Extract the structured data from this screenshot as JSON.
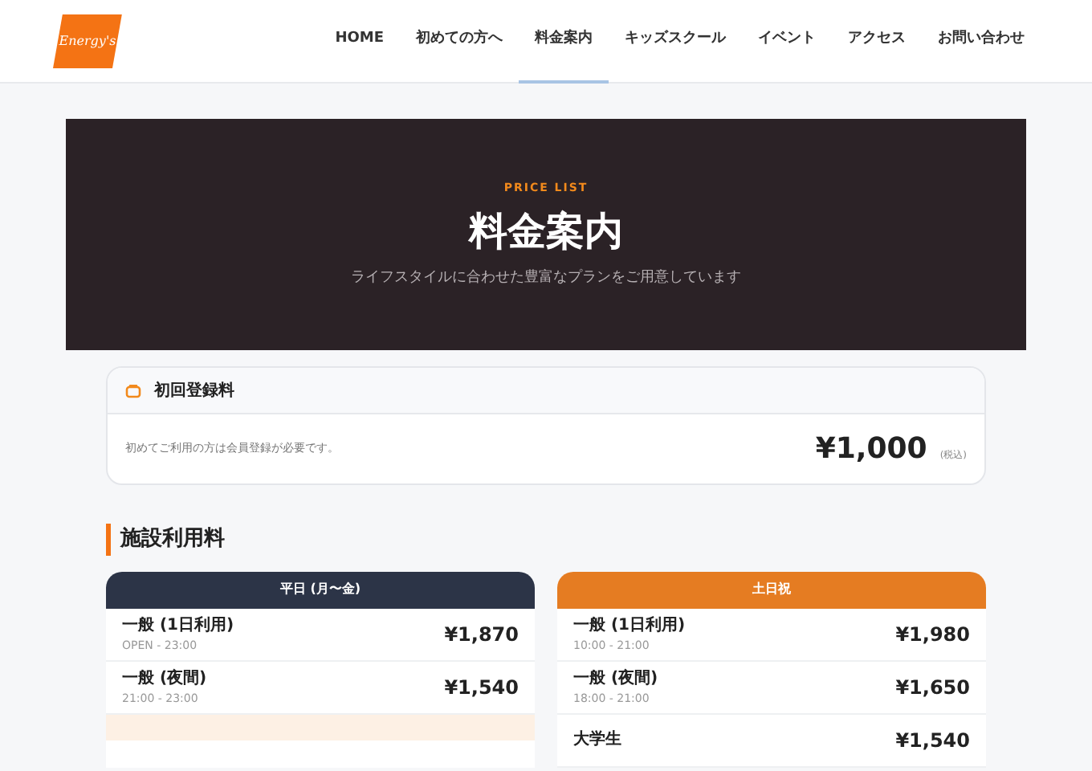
{
  "logo": {
    "text": "Energy's"
  },
  "nav": [
    {
      "label": "HOME",
      "selected": false
    },
    {
      "label": "初めての方へ",
      "selected": false
    },
    {
      "label": "料金案内",
      "selected": true
    },
    {
      "label": "キッズスクール",
      "selected": false
    },
    {
      "label": "イベント",
      "selected": false
    },
    {
      "label": "アクセス",
      "selected": false
    },
    {
      "label": "お問い合わせ",
      "selected": false
    }
  ],
  "hero": {
    "eyebrow": "PRICE LIST",
    "title": "料金案内",
    "subtitle": "ライフスタイルに合わせた豊富なプランをご用意しています"
  },
  "registration": {
    "title": "初回登録料",
    "note": "初めてご利用の方は会員登録が必要です。",
    "price": "¥1,000",
    "tax": "(税込)"
  },
  "section_title": "施設利用料",
  "plans": [
    {
      "title": "平日 (月〜金)",
      "kind": "weekday",
      "rows": [
        {
          "name": "一般 (1日利用)",
          "hours": "OPEN - 23:00",
          "price": "¥1,870"
        },
        {
          "name": "一般 (夜間)",
          "hours": "21:00 - 23:00",
          "price": "¥1,540"
        }
      ],
      "has_highlight_row": true
    },
    {
      "title": "土日祝",
      "kind": "weekend",
      "rows": [
        {
          "name": "一般 (1日利用)",
          "hours": "10:00 - 21:00",
          "price": "¥1,980"
        },
        {
          "name": "一般 (夜間)",
          "hours": "18:00 - 21:00",
          "price": "¥1,650"
        },
        {
          "name": "大学生",
          "price": "¥1,540"
        }
      ],
      "has_highlight_row": false
    }
  ]
}
